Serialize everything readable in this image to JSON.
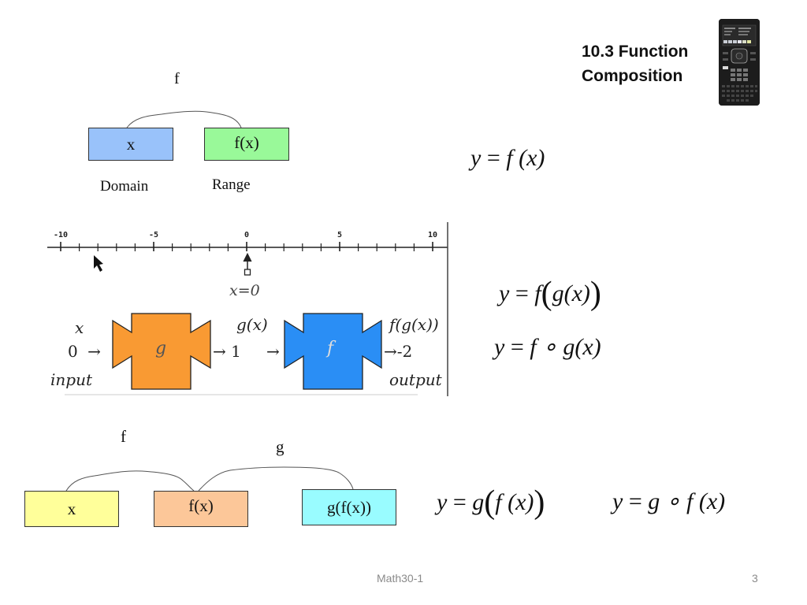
{
  "slide": {
    "title_line1": "10.3 Function",
    "title_line2": "Composition",
    "calculator_image": "graphing-calculator-image"
  },
  "diagram1": {
    "arc_label": "f",
    "domain_box": "x",
    "range_box": "f(x)",
    "domain_label": "Domain",
    "range_label": "Range",
    "colors": {
      "domain": "#99c2fa",
      "range": "#99f999"
    }
  },
  "equations": {
    "eq1": {
      "lhs": "y",
      "eq": "=",
      "rhs": "f (x)"
    },
    "eq2": {
      "lhs": "y",
      "eq": "=",
      "f": "f",
      "inner": "g(x)"
    },
    "eq3": {
      "lhs": "y",
      "eq": "=",
      "rhs": "f ∘ g(x)"
    },
    "eq4": {
      "lhs": "y",
      "eq": "=",
      "g": "g",
      "inner": "f (x)"
    },
    "eq5": {
      "lhs": "y",
      "eq": "=",
      "rhs": "g ∘ f (x)"
    }
  },
  "number_line": {
    "min": -10,
    "max": 10,
    "labeled_ticks": [
      "-10",
      "-5",
      "0",
      "5",
      "10"
    ],
    "point_label": "x=0",
    "point_value": 0
  },
  "machine": {
    "input_var": "x",
    "input_value": "0",
    "input_label": "input",
    "g_label": "g",
    "g_output_var": "g(x)",
    "g_output_value": "1",
    "f_label": "f",
    "f_output_var": "f(g(x))",
    "f_output_value": "-2",
    "output_label": "output",
    "arrow": "→",
    "colors": {
      "g": "#f99a33",
      "f": "#2a8ef5"
    }
  },
  "diagram2": {
    "arc_f_label": "f",
    "arc_g_label": "g",
    "box1": "x",
    "box2": "f(x)",
    "box3": "g(f(x))",
    "colors": {
      "box1": "#ffff9a",
      "box2": "#fcc799",
      "box3": "#99fcff"
    }
  },
  "footer": {
    "course": "Math30-1",
    "page_number": "3"
  }
}
